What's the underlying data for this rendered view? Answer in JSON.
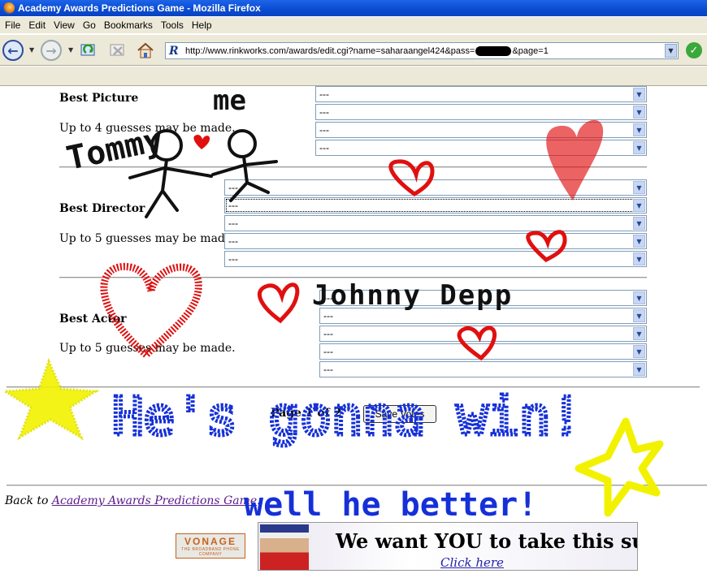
{
  "window": {
    "title": "Academy Awards Predictions Game - Mozilla Firefox"
  },
  "menu": [
    "File",
    "Edit",
    "View",
    "Go",
    "Bookmarks",
    "Tools",
    "Help"
  ],
  "address": {
    "url": "http://www.rinkworks.com/awards/edit.cgi?name=saharaangel424&pass=",
    "url_tail": "&page=1"
  },
  "categories": [
    {
      "title": "Best Picture",
      "hint": "Up to 4 guesses may be made.",
      "options": [
        "---",
        "---",
        "---",
        "---"
      ]
    },
    {
      "title": "Best Director",
      "hint": "Up to 5 guesses may be made.",
      "options": [
        "---",
        "---",
        "---",
        "---",
        "---"
      ]
    },
    {
      "title": "Best Actor",
      "hint": "Up to 5 guesses may be made.",
      "options": [
        "---",
        "---",
        "---",
        "---",
        "---"
      ]
    }
  ],
  "pager": {
    "label": "Page 1 of 2",
    "save_label": "Save Votes"
  },
  "back": {
    "prefix": "Back to ",
    "link": "Academy Awards Predictions Game",
    "suffix": "."
  },
  "ads": {
    "vonage_brand": "VONAGE",
    "vonage_tag": "THE BROADBAND PHONE COMPANY",
    "survey_headline": "We want YOU to take this survey!",
    "survey_link": "Click here"
  },
  "drawings": {
    "me": "me",
    "tommy": "Tommy",
    "johnny_depp": "Johnny Depp",
    "hes_gonna_win": "He's gonna win!",
    "well_he_better": "well he better!"
  },
  "colors": {
    "scribble_red": "#e01010",
    "scribble_blue": "#1530d8",
    "scribble_yellow": "#f2f200",
    "scribble_black": "#111111"
  }
}
